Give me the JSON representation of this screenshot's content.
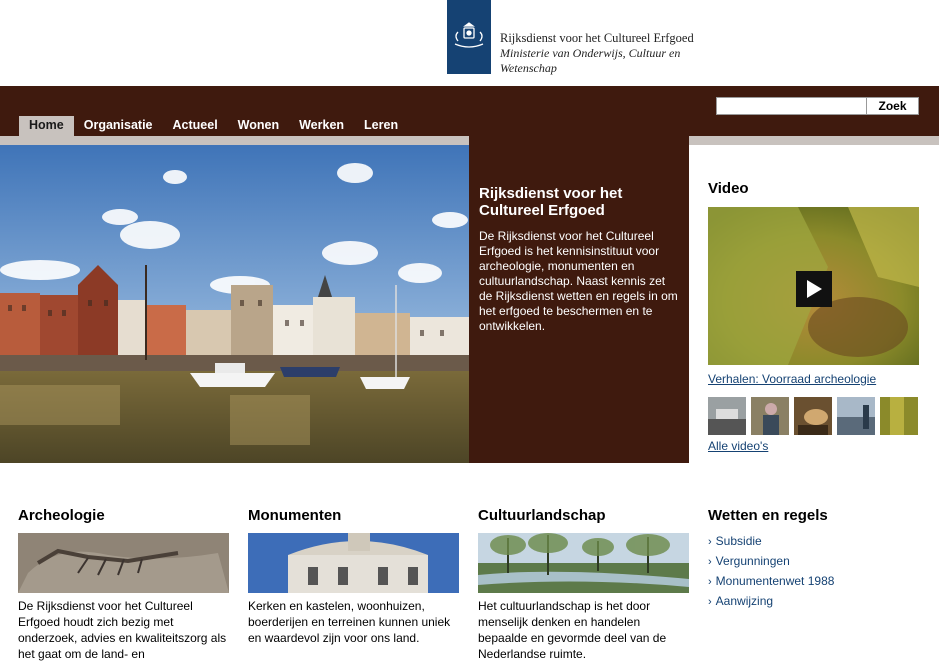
{
  "logo": {
    "title": "Rijksdienst voor het Cultureel Erfgoed",
    "ministry_line1": "Ministerie van Onderwijs, Cultuur en",
    "ministry_line2": "Wetenschap"
  },
  "nav": {
    "items": [
      {
        "label": "Home",
        "active": true
      },
      {
        "label": "Organisatie"
      },
      {
        "label": "Actueel"
      },
      {
        "label": "Wonen"
      },
      {
        "label": "Werken"
      },
      {
        "label": "Leren"
      }
    ]
  },
  "search": {
    "value": "",
    "button_label": "Zoek"
  },
  "hero": {
    "title": "Rijksdienst voor het Cultureel Erfgoed",
    "text": "De Rijksdienst voor het Cultureel Erfgoed is het kennisinstituut voor archeologie, monumenten en cultuurlandschap. Naast kennis zet de Rijksdienst wetten en regels in om het erfgoed te beschermen en te ontwikkelen."
  },
  "video": {
    "title": "Video",
    "link_label": "Verhalen: Voorraad archeologie",
    "all_label": "Alle video's"
  },
  "columns": [
    {
      "title": "Archeologie",
      "text": "De Rijksdienst voor het Cultureel Erfgoed houdt zich bezig met onderzoek, advies en kwaliteitszorg als het gaat om de land- en scheepsarcheologie."
    },
    {
      "title": "Monumenten",
      "text": "Kerken en kastelen, woonhuizen, boerderijen en terreinen kunnen uniek en waardevol zijn voor ons land."
    },
    {
      "title": "Cultuurlandschap",
      "text": "Het cultuurlandschap is het door menselijk denken en handelen bepaalde en gevormde deel van de Nederlandse ruimte."
    },
    {
      "title": "Wetten en regels",
      "links": [
        "Subsidie",
        "Vergunningen",
        "Monumentenwet 1988",
        "Aanwijzing"
      ]
    }
  ],
  "colors": {
    "brown": "#3f1a0e",
    "grey_band": "#c8c2be",
    "logo_blue": "#154273",
    "link_blue": "#154273"
  }
}
